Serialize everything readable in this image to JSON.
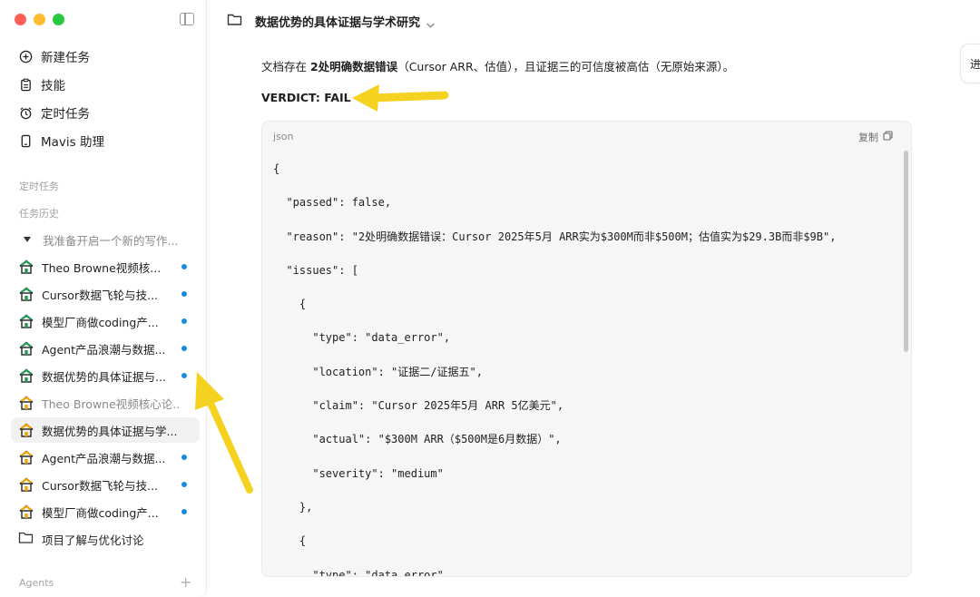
{
  "sidebar": {
    "nav": [
      {
        "label": "新建任务",
        "icon": "plus-circle-icon"
      },
      {
        "label": "技能",
        "icon": "clipboard-icon"
      },
      {
        "label": "定时任务",
        "icon": "alarm-clock-icon"
      },
      {
        "label": "Mavis 助理",
        "icon": "phone-icon"
      }
    ],
    "sections": {
      "scheduled": "定时任务",
      "history": "任务历史",
      "agents": "Agents",
      "agents_add": "+"
    },
    "history": [
      {
        "label": "我准备开启一个新的写作...",
        "type": "draft",
        "dot": false,
        "dim": true
      },
      {
        "label": "Theo Browne视频核...",
        "type": "house-green",
        "dot": true
      },
      {
        "label": "Cursor数据飞轮与技...",
        "type": "house-green",
        "dot": true
      },
      {
        "label": "模型厂商做coding产...",
        "type": "house-green",
        "dot": true
      },
      {
        "label": "Agent产品浪潮与数据...",
        "type": "house-green",
        "dot": true
      },
      {
        "label": "数据优势的具体证据与...",
        "type": "house-green",
        "dot": true
      },
      {
        "label": "Theo Browne视频核心论...",
        "type": "house-orange",
        "dot": false,
        "dim": true
      },
      {
        "label": "数据优势的具体证据与学...",
        "type": "house-orange",
        "dot": false,
        "active": true
      },
      {
        "label": "Agent产品浪潮与数据...",
        "type": "house-orange",
        "dot": true
      },
      {
        "label": "Cursor数据飞轮与技...",
        "type": "house-orange",
        "dot": true
      },
      {
        "label": "模型厂商做coding产...",
        "type": "house-orange",
        "dot": true
      },
      {
        "label": "项目了解与优化讨论",
        "type": "folder",
        "dot": false
      }
    ]
  },
  "header": {
    "title": "数据优势的具体证据与学术研究"
  },
  "side_tab": "进",
  "content": {
    "summary_prefix": "文档存在 ",
    "summary_bold": "2处明确数据错误",
    "summary_suffix": "（Cursor ARR、估值），且证据三的可信度被高估（无原始来源）。",
    "verdict": "VERDICT: FAIL"
  },
  "code": {
    "lang": "json",
    "copy_label": "复制",
    "lines": [
      "{",
      "  \"passed\": false,",
      "  \"reason\": \"2处明确数据错误：Cursor 2025年5月 ARR实为$300M而非$500M；估值实为$29.3B而非$9B\",",
      "  \"issues\": [",
      "    {",
      "      \"type\": \"data_error\",",
      "      \"location\": \"证据二/证据五\",",
      "      \"claim\": \"Cursor 2025年5月 ARR 5亿美元\",",
      "      \"actual\": \"$300M ARR（$500M是6月数据）\",",
      "      \"severity\": \"medium\"",
      "    },",
      "    {",
      "      \"type\": \"data_error\","
    ]
  },
  "colors": {
    "accent_dot": "#1b8be0",
    "arrow": "#f5d21f"
  }
}
